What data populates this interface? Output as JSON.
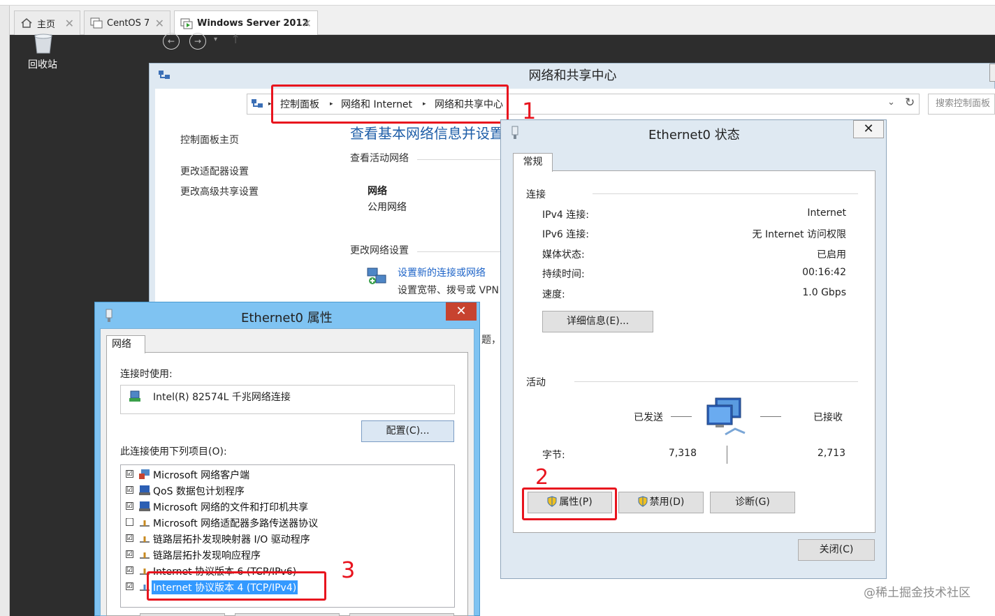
{
  "host": {
    "tabs": [
      {
        "label": "主页"
      },
      {
        "label": "CentOS 7"
      },
      {
        "label": "Windows Server 2012"
      }
    ]
  },
  "desktop": {
    "recycle_bin_label": "回收站",
    "watermark": "@稀土掘金技术社区"
  },
  "nsc": {
    "title": "网络和共享中心",
    "breadcrumb": [
      "控制面板",
      "网络和 Internet",
      "网络和共享中心"
    ],
    "search_placeholder": "搜索控制面板",
    "sidebar": [
      "控制面板主页",
      "更改适配器设置",
      "更改高级共享设置"
    ],
    "heading": "查看基本网络信息并设置",
    "active_networks_label": "查看活动网络",
    "network_name": "网络",
    "network_type": "公用网络",
    "change_settings_label": "更改网络设置",
    "setup_link": "设置新的连接或网络",
    "setup_desc": "设置宽带、拨号或 VPN",
    "partial_text": "题，"
  },
  "status_dialog": {
    "title": "Ethernet0 状态",
    "close": "✕",
    "tab": "常规",
    "connection_label": "连接",
    "rows": [
      {
        "label": "IPv4 连接:",
        "value": "Internet"
      },
      {
        "label": "IPv6 连接:",
        "value": "无 Internet 访问权限"
      },
      {
        "label": "媒体状态:",
        "value": "已启用"
      },
      {
        "label": "持续时间:",
        "value": "00:16:42"
      },
      {
        "label": "速度:",
        "value": "1.0 Gbps"
      }
    ],
    "details_button": "详细信息(E)...",
    "activity_label": "活动",
    "sent_label": "已发送",
    "received_label": "已接收",
    "bytes_label": "字节:",
    "bytes_sent": "7,318",
    "bytes_received": "2,713",
    "properties_button": "属性(P)",
    "disable_button": "禁用(D)",
    "diagnose_button": "诊断(G)",
    "close_button": "关闭(C)"
  },
  "prop_dialog": {
    "title": "Ethernet0 属性",
    "close": "✕",
    "tab": "网络",
    "connect_using_label": "连接时使用:",
    "adapter": "Intel(R) 82574L 千兆网络连接",
    "configure_button": "配置(C)...",
    "items_label": "此连接使用下列项目(O):",
    "items": [
      {
        "label": "Microsoft 网络客户端",
        "checked": "☑"
      },
      {
        "label": "QoS 数据包计划程序",
        "checked": "☑"
      },
      {
        "label": "Microsoft 网络的文件和打印机共享",
        "checked": "☑"
      },
      {
        "label": "Microsoft 网络适配器多路传送器协议",
        "checked": "☐"
      },
      {
        "label": "链路层拓扑发现映射器 I/O 驱动程序",
        "checked": "☑"
      },
      {
        "label": "链路层拓扑发现响应程序",
        "checked": "☑"
      },
      {
        "label": "Internet 协议版本 6 (TCP/IPv6)",
        "checked": "☑"
      },
      {
        "label": "Internet 协议版本 4 (TCP/IPv4)",
        "checked": "☑"
      }
    ]
  },
  "annotations": {
    "n1": "1",
    "n2": "2",
    "n3": "3"
  },
  "colors": {
    "annotation_red": "#e8141e",
    "link_blue": "#1e64c8",
    "selection_blue": "#3399ff",
    "dialog_cyan": "#7fc3f2",
    "close_red": "#c7432f"
  }
}
